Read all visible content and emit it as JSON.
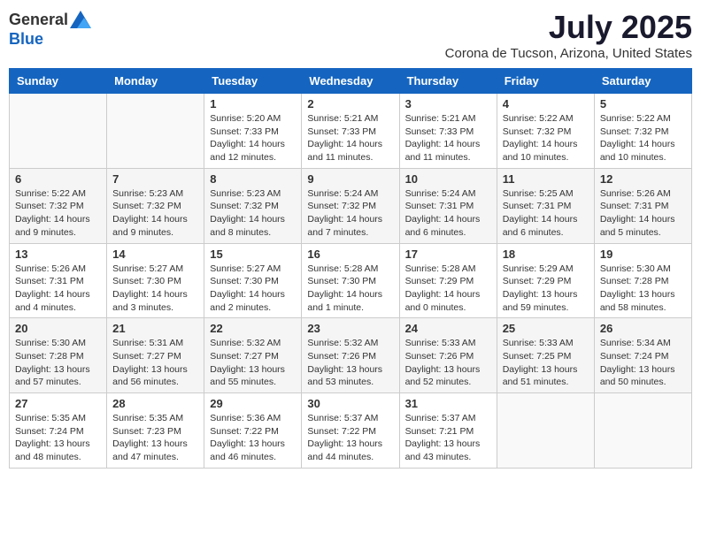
{
  "header": {
    "logo_general": "General",
    "logo_blue": "Blue",
    "month_title": "July 2025",
    "location": "Corona de Tucson, Arizona, United States"
  },
  "days_of_week": [
    "Sunday",
    "Monday",
    "Tuesday",
    "Wednesday",
    "Thursday",
    "Friday",
    "Saturday"
  ],
  "weeks": [
    [
      {
        "day": "",
        "sunrise": "",
        "sunset": "",
        "daylight": ""
      },
      {
        "day": "",
        "sunrise": "",
        "sunset": "",
        "daylight": ""
      },
      {
        "day": "1",
        "sunrise": "Sunrise: 5:20 AM",
        "sunset": "Sunset: 7:33 PM",
        "daylight": "Daylight: 14 hours and 12 minutes."
      },
      {
        "day": "2",
        "sunrise": "Sunrise: 5:21 AM",
        "sunset": "Sunset: 7:33 PM",
        "daylight": "Daylight: 14 hours and 11 minutes."
      },
      {
        "day": "3",
        "sunrise": "Sunrise: 5:21 AM",
        "sunset": "Sunset: 7:33 PM",
        "daylight": "Daylight: 14 hours and 11 minutes."
      },
      {
        "day": "4",
        "sunrise": "Sunrise: 5:22 AM",
        "sunset": "Sunset: 7:32 PM",
        "daylight": "Daylight: 14 hours and 10 minutes."
      },
      {
        "day": "5",
        "sunrise": "Sunrise: 5:22 AM",
        "sunset": "Sunset: 7:32 PM",
        "daylight": "Daylight: 14 hours and 10 minutes."
      }
    ],
    [
      {
        "day": "6",
        "sunrise": "Sunrise: 5:22 AM",
        "sunset": "Sunset: 7:32 PM",
        "daylight": "Daylight: 14 hours and 9 minutes."
      },
      {
        "day": "7",
        "sunrise": "Sunrise: 5:23 AM",
        "sunset": "Sunset: 7:32 PM",
        "daylight": "Daylight: 14 hours and 9 minutes."
      },
      {
        "day": "8",
        "sunrise": "Sunrise: 5:23 AM",
        "sunset": "Sunset: 7:32 PM",
        "daylight": "Daylight: 14 hours and 8 minutes."
      },
      {
        "day": "9",
        "sunrise": "Sunrise: 5:24 AM",
        "sunset": "Sunset: 7:32 PM",
        "daylight": "Daylight: 14 hours and 7 minutes."
      },
      {
        "day": "10",
        "sunrise": "Sunrise: 5:24 AM",
        "sunset": "Sunset: 7:31 PM",
        "daylight": "Daylight: 14 hours and 6 minutes."
      },
      {
        "day": "11",
        "sunrise": "Sunrise: 5:25 AM",
        "sunset": "Sunset: 7:31 PM",
        "daylight": "Daylight: 14 hours and 6 minutes."
      },
      {
        "day": "12",
        "sunrise": "Sunrise: 5:26 AM",
        "sunset": "Sunset: 7:31 PM",
        "daylight": "Daylight: 14 hours and 5 minutes."
      }
    ],
    [
      {
        "day": "13",
        "sunrise": "Sunrise: 5:26 AM",
        "sunset": "Sunset: 7:31 PM",
        "daylight": "Daylight: 14 hours and 4 minutes."
      },
      {
        "day": "14",
        "sunrise": "Sunrise: 5:27 AM",
        "sunset": "Sunset: 7:30 PM",
        "daylight": "Daylight: 14 hours and 3 minutes."
      },
      {
        "day": "15",
        "sunrise": "Sunrise: 5:27 AM",
        "sunset": "Sunset: 7:30 PM",
        "daylight": "Daylight: 14 hours and 2 minutes."
      },
      {
        "day": "16",
        "sunrise": "Sunrise: 5:28 AM",
        "sunset": "Sunset: 7:30 PM",
        "daylight": "Daylight: 14 hours and 1 minute."
      },
      {
        "day": "17",
        "sunrise": "Sunrise: 5:28 AM",
        "sunset": "Sunset: 7:29 PM",
        "daylight": "Daylight: 14 hours and 0 minutes."
      },
      {
        "day": "18",
        "sunrise": "Sunrise: 5:29 AM",
        "sunset": "Sunset: 7:29 PM",
        "daylight": "Daylight: 13 hours and 59 minutes."
      },
      {
        "day": "19",
        "sunrise": "Sunrise: 5:30 AM",
        "sunset": "Sunset: 7:28 PM",
        "daylight": "Daylight: 13 hours and 58 minutes."
      }
    ],
    [
      {
        "day": "20",
        "sunrise": "Sunrise: 5:30 AM",
        "sunset": "Sunset: 7:28 PM",
        "daylight": "Daylight: 13 hours and 57 minutes."
      },
      {
        "day": "21",
        "sunrise": "Sunrise: 5:31 AM",
        "sunset": "Sunset: 7:27 PM",
        "daylight": "Daylight: 13 hours and 56 minutes."
      },
      {
        "day": "22",
        "sunrise": "Sunrise: 5:32 AM",
        "sunset": "Sunset: 7:27 PM",
        "daylight": "Daylight: 13 hours and 55 minutes."
      },
      {
        "day": "23",
        "sunrise": "Sunrise: 5:32 AM",
        "sunset": "Sunset: 7:26 PM",
        "daylight": "Daylight: 13 hours and 53 minutes."
      },
      {
        "day": "24",
        "sunrise": "Sunrise: 5:33 AM",
        "sunset": "Sunset: 7:26 PM",
        "daylight": "Daylight: 13 hours and 52 minutes."
      },
      {
        "day": "25",
        "sunrise": "Sunrise: 5:33 AM",
        "sunset": "Sunset: 7:25 PM",
        "daylight": "Daylight: 13 hours and 51 minutes."
      },
      {
        "day": "26",
        "sunrise": "Sunrise: 5:34 AM",
        "sunset": "Sunset: 7:24 PM",
        "daylight": "Daylight: 13 hours and 50 minutes."
      }
    ],
    [
      {
        "day": "27",
        "sunrise": "Sunrise: 5:35 AM",
        "sunset": "Sunset: 7:24 PM",
        "daylight": "Daylight: 13 hours and 48 minutes."
      },
      {
        "day": "28",
        "sunrise": "Sunrise: 5:35 AM",
        "sunset": "Sunset: 7:23 PM",
        "daylight": "Daylight: 13 hours and 47 minutes."
      },
      {
        "day": "29",
        "sunrise": "Sunrise: 5:36 AM",
        "sunset": "Sunset: 7:22 PM",
        "daylight": "Daylight: 13 hours and 46 minutes."
      },
      {
        "day": "30",
        "sunrise": "Sunrise: 5:37 AM",
        "sunset": "Sunset: 7:22 PM",
        "daylight": "Daylight: 13 hours and 44 minutes."
      },
      {
        "day": "31",
        "sunrise": "Sunrise: 5:37 AM",
        "sunset": "Sunset: 7:21 PM",
        "daylight": "Daylight: 13 hours and 43 minutes."
      },
      {
        "day": "",
        "sunrise": "",
        "sunset": "",
        "daylight": ""
      },
      {
        "day": "",
        "sunrise": "",
        "sunset": "",
        "daylight": ""
      }
    ]
  ]
}
